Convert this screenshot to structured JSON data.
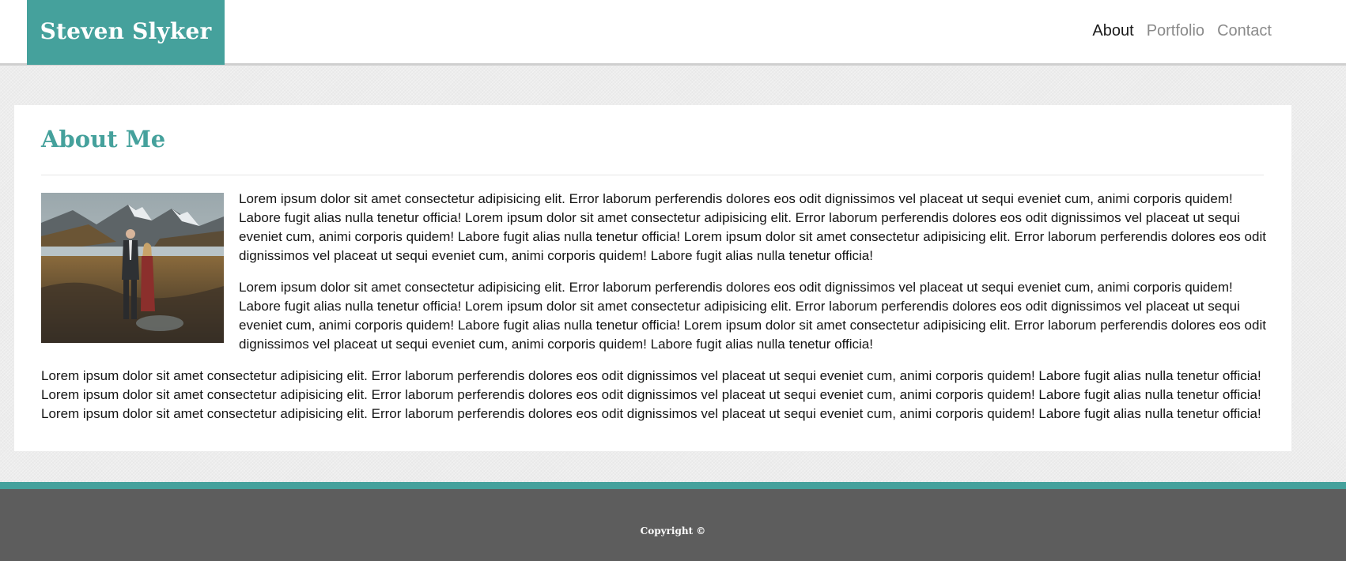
{
  "header": {
    "logo_text": "Steven Slyker",
    "brand_color": "#45a19c",
    "nav": [
      {
        "label": "About",
        "active": true
      },
      {
        "label": "Portfolio",
        "active": false
      },
      {
        "label": "Contact",
        "active": false
      }
    ]
  },
  "main": {
    "title": "About Me",
    "paragraphs": [
      "Lorem ipsum dolor sit amet consectetur adipisicing elit. Error laborum perferendis dolores eos odit dignissimos vel placeat ut sequi eveniet cum, animi corporis quidem! Labore fugit alias nulla tenetur officia! Lorem ipsum dolor sit amet consectetur adipisicing elit. Error laborum perferendis dolores eos odit dignissimos vel placeat ut sequi eveniet cum, animi corporis quidem! Labore fugit alias nulla tenetur officia! Lorem ipsum dolor sit amet consectetur adipisicing elit. Error laborum perferendis dolores eos odit dignissimos vel placeat ut sequi eveniet cum, animi corporis quidem! Labore fugit alias nulla tenetur officia!",
      "Lorem ipsum dolor sit amet consectetur adipisicing elit. Error laborum perferendis dolores eos odit dignissimos vel placeat ut sequi eveniet cum, animi corporis quidem! Labore fugit alias nulla tenetur officia! Lorem ipsum dolor sit amet consectetur adipisicing elit. Error laborum perferendis dolores eos odit dignissimos vel placeat ut sequi eveniet cum, animi corporis quidem! Labore fugit alias nulla tenetur officia! Lorem ipsum dolor sit amet consectetur adipisicing elit. Error laborum perferendis dolores eos odit dignissimos vel placeat ut sequi eveniet cum, animi corporis quidem! Labore fugit alias nulla tenetur officia!",
      "Lorem ipsum dolor sit amet consectetur adipisicing elit. Error laborum perferendis dolores eos odit dignissimos vel placeat ut sequi eveniet cum, animi corporis quidem! Labore fugit alias nulla tenetur officia! Lorem ipsum dolor sit amet consectetur adipisicing elit. Error laborum perferendis dolores eos odit dignissimos vel placeat ut sequi eveniet cum, animi corporis quidem! Labore fugit alias nulla tenetur officia! Lorem ipsum dolor sit amet consectetur adipisicing elit. Error laborum perferendis dolores eos odit dignissimos vel placeat ut sequi eveniet cum, animi corporis quidem! Labore fugit alias nulla tenetur officia!"
    ]
  },
  "footer": {
    "copyright": "Copyright ©",
    "bar_color": "#5d5d5d"
  }
}
